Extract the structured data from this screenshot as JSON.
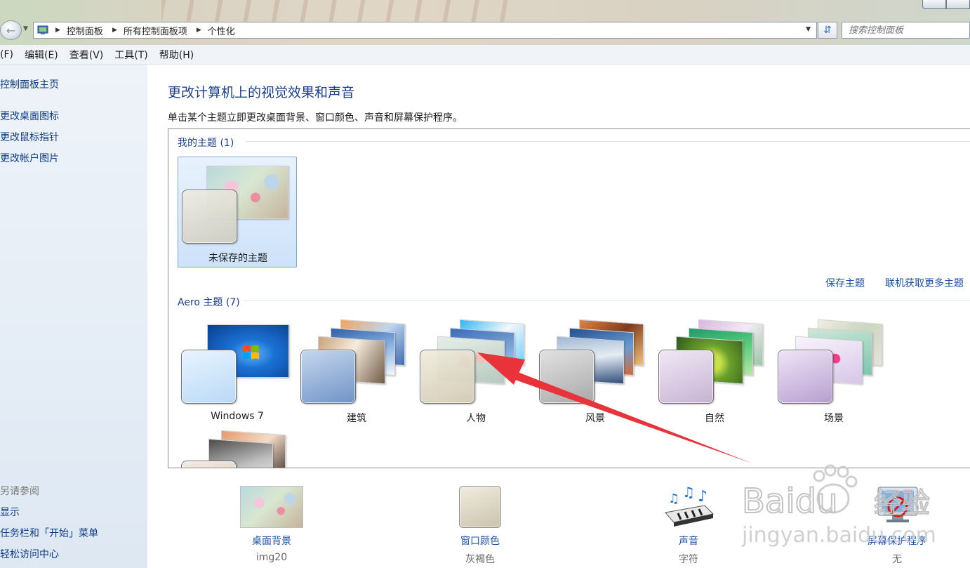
{
  "address_bar": {
    "crumbs": [
      "控制面板",
      "所有控制面板项",
      "个性化"
    ],
    "search_placeholder": "搜索控制面板"
  },
  "menu": [
    "(F)",
    "编辑(E)",
    "查看(V)",
    "工具(T)",
    "帮助(H)"
  ],
  "left_panel": {
    "links": [
      "控制面板主页",
      "更改桌面图标",
      "更改鼠标指针",
      "更改帐户图片"
    ],
    "see_also_title": "另请参阅",
    "see_also": [
      "显示",
      "任务栏和「开始」菜单",
      "轻松访问中心"
    ]
  },
  "main": {
    "title": "更改计算机上的视觉效果和声音",
    "description": "单击某个主题立即更改桌面背景、窗口颜色、声音和屏幕保护程序。",
    "my_themes": {
      "title": "我的主题 (1)",
      "items": [
        {
          "label": "未保存的主题",
          "selected": true
        }
      ]
    },
    "save_theme_link": "保存主题",
    "get_more_link": "联机获取更多主题",
    "aero_themes": {
      "title": "Aero 主题 (7)",
      "items": [
        {
          "label": "Windows 7"
        },
        {
          "label": "建筑"
        },
        {
          "label": "人物"
        },
        {
          "label": "风景"
        },
        {
          "label": "自然"
        },
        {
          "label": "场景"
        }
      ]
    }
  },
  "bottom": [
    {
      "label": "桌面背景",
      "value": "img20",
      "icon": "desktop-background-thumbnail"
    },
    {
      "label": "窗口颜色",
      "value": "灰褐色",
      "icon": "window-color-swatch"
    },
    {
      "label": "声音",
      "value": "字符",
      "icon": "piano-music-icon"
    },
    {
      "label": "屏幕保护程序",
      "value": "无",
      "icon": "screensaver-icon"
    }
  ],
  "watermark": {
    "brand": "Baidu",
    "brand_cn": "经验",
    "url": "jingyan.baidu.com"
  },
  "colors": {
    "link": "#1a52a8",
    "title": "#1a3f8f",
    "annotation_arrow": "#e8333b"
  }
}
